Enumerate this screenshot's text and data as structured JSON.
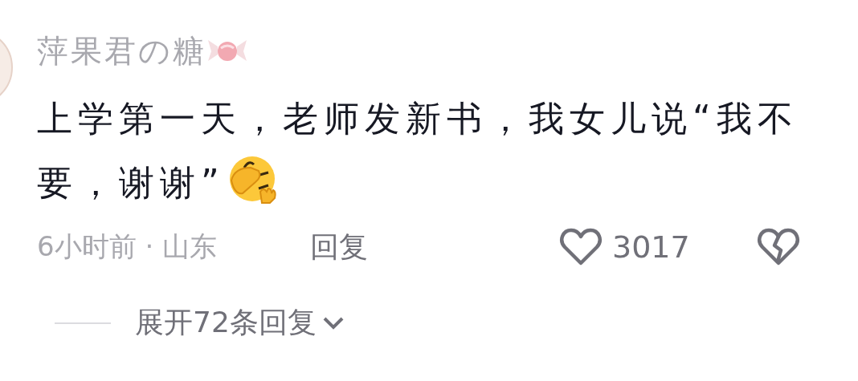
{
  "comment": {
    "username": "萍果君の糖",
    "text_lines": [
      "上学第一天，老师发新书，我女儿说“我不",
      "要，谢谢”"
    ],
    "meta": "6小时前 · 山东",
    "reply_label": "回复",
    "likes": "3017",
    "liked": false
  },
  "expand_replies": "展开72条回复"
}
